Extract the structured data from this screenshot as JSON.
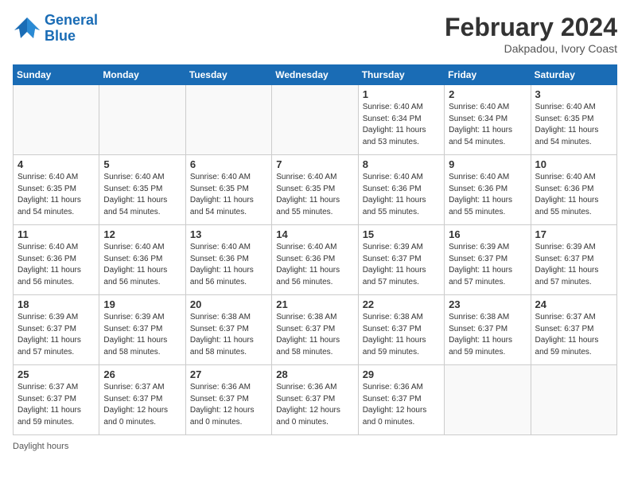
{
  "header": {
    "logo_line1": "General",
    "logo_line2": "Blue",
    "month_year": "February 2024",
    "location": "Dakpadou, Ivory Coast"
  },
  "days_of_week": [
    "Sunday",
    "Monday",
    "Tuesday",
    "Wednesday",
    "Thursday",
    "Friday",
    "Saturday"
  ],
  "weeks": [
    [
      {
        "num": "",
        "info": "",
        "empty": true
      },
      {
        "num": "",
        "info": "",
        "empty": true
      },
      {
        "num": "",
        "info": "",
        "empty": true
      },
      {
        "num": "",
        "info": "",
        "empty": true
      },
      {
        "num": "1",
        "info": "Sunrise: 6:40 AM\nSunset: 6:34 PM\nDaylight: 11 hours\nand 53 minutes.",
        "empty": false
      },
      {
        "num": "2",
        "info": "Sunrise: 6:40 AM\nSunset: 6:34 PM\nDaylight: 11 hours\nand 54 minutes.",
        "empty": false
      },
      {
        "num": "3",
        "info": "Sunrise: 6:40 AM\nSunset: 6:35 PM\nDaylight: 11 hours\nand 54 minutes.",
        "empty": false
      }
    ],
    [
      {
        "num": "4",
        "info": "Sunrise: 6:40 AM\nSunset: 6:35 PM\nDaylight: 11 hours\nand 54 minutes.",
        "empty": false
      },
      {
        "num": "5",
        "info": "Sunrise: 6:40 AM\nSunset: 6:35 PM\nDaylight: 11 hours\nand 54 minutes.",
        "empty": false
      },
      {
        "num": "6",
        "info": "Sunrise: 6:40 AM\nSunset: 6:35 PM\nDaylight: 11 hours\nand 54 minutes.",
        "empty": false
      },
      {
        "num": "7",
        "info": "Sunrise: 6:40 AM\nSunset: 6:35 PM\nDaylight: 11 hours\nand 55 minutes.",
        "empty": false
      },
      {
        "num": "8",
        "info": "Sunrise: 6:40 AM\nSunset: 6:36 PM\nDaylight: 11 hours\nand 55 minutes.",
        "empty": false
      },
      {
        "num": "9",
        "info": "Sunrise: 6:40 AM\nSunset: 6:36 PM\nDaylight: 11 hours\nand 55 minutes.",
        "empty": false
      },
      {
        "num": "10",
        "info": "Sunrise: 6:40 AM\nSunset: 6:36 PM\nDaylight: 11 hours\nand 55 minutes.",
        "empty": false
      }
    ],
    [
      {
        "num": "11",
        "info": "Sunrise: 6:40 AM\nSunset: 6:36 PM\nDaylight: 11 hours\nand 56 minutes.",
        "empty": false
      },
      {
        "num": "12",
        "info": "Sunrise: 6:40 AM\nSunset: 6:36 PM\nDaylight: 11 hours\nand 56 minutes.",
        "empty": false
      },
      {
        "num": "13",
        "info": "Sunrise: 6:40 AM\nSunset: 6:36 PM\nDaylight: 11 hours\nand 56 minutes.",
        "empty": false
      },
      {
        "num": "14",
        "info": "Sunrise: 6:40 AM\nSunset: 6:36 PM\nDaylight: 11 hours\nand 56 minutes.",
        "empty": false
      },
      {
        "num": "15",
        "info": "Sunrise: 6:39 AM\nSunset: 6:37 PM\nDaylight: 11 hours\nand 57 minutes.",
        "empty": false
      },
      {
        "num": "16",
        "info": "Sunrise: 6:39 AM\nSunset: 6:37 PM\nDaylight: 11 hours\nand 57 minutes.",
        "empty": false
      },
      {
        "num": "17",
        "info": "Sunrise: 6:39 AM\nSunset: 6:37 PM\nDaylight: 11 hours\nand 57 minutes.",
        "empty": false
      }
    ],
    [
      {
        "num": "18",
        "info": "Sunrise: 6:39 AM\nSunset: 6:37 PM\nDaylight: 11 hours\nand 57 minutes.",
        "empty": false
      },
      {
        "num": "19",
        "info": "Sunrise: 6:39 AM\nSunset: 6:37 PM\nDaylight: 11 hours\nand 58 minutes.",
        "empty": false
      },
      {
        "num": "20",
        "info": "Sunrise: 6:38 AM\nSunset: 6:37 PM\nDaylight: 11 hours\nand 58 minutes.",
        "empty": false
      },
      {
        "num": "21",
        "info": "Sunrise: 6:38 AM\nSunset: 6:37 PM\nDaylight: 11 hours\nand 58 minutes.",
        "empty": false
      },
      {
        "num": "22",
        "info": "Sunrise: 6:38 AM\nSunset: 6:37 PM\nDaylight: 11 hours\nand 59 minutes.",
        "empty": false
      },
      {
        "num": "23",
        "info": "Sunrise: 6:38 AM\nSunset: 6:37 PM\nDaylight: 11 hours\nand 59 minutes.",
        "empty": false
      },
      {
        "num": "24",
        "info": "Sunrise: 6:37 AM\nSunset: 6:37 PM\nDaylight: 11 hours\nand 59 minutes.",
        "empty": false
      }
    ],
    [
      {
        "num": "25",
        "info": "Sunrise: 6:37 AM\nSunset: 6:37 PM\nDaylight: 11 hours\nand 59 minutes.",
        "empty": false
      },
      {
        "num": "26",
        "info": "Sunrise: 6:37 AM\nSunset: 6:37 PM\nDaylight: 12 hours\nand 0 minutes.",
        "empty": false
      },
      {
        "num": "27",
        "info": "Sunrise: 6:36 AM\nSunset: 6:37 PM\nDaylight: 12 hours\nand 0 minutes.",
        "empty": false
      },
      {
        "num": "28",
        "info": "Sunrise: 6:36 AM\nSunset: 6:37 PM\nDaylight: 12 hours\nand 0 minutes.",
        "empty": false
      },
      {
        "num": "29",
        "info": "Sunrise: 6:36 AM\nSunset: 6:37 PM\nDaylight: 12 hours\nand 0 minutes.",
        "empty": false
      },
      {
        "num": "",
        "info": "",
        "empty": true
      },
      {
        "num": "",
        "info": "",
        "empty": true
      }
    ]
  ],
  "footer": {
    "label": "Daylight hours"
  }
}
